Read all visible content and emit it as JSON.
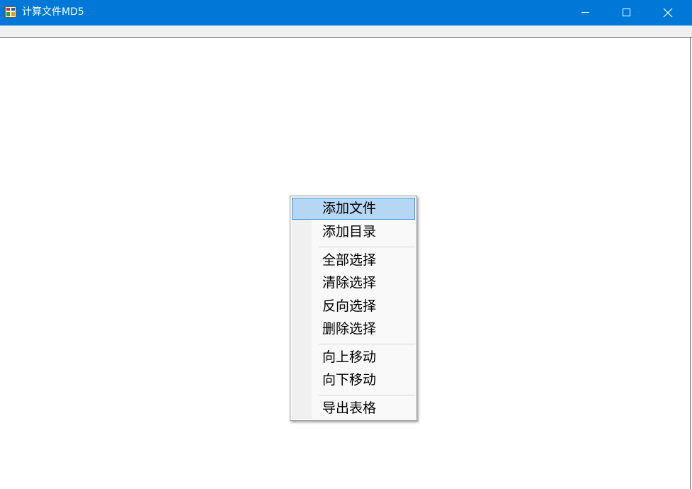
{
  "window": {
    "title": "计算文件MD5",
    "accent_color": "#0078d7",
    "icon": "app-icon",
    "controls": {
      "minimize_icon": "minimize-icon",
      "maximize_icon": "maximize-icon",
      "close_icon": "close-icon"
    }
  },
  "context_menu": {
    "groups": [
      [
        "添加文件",
        "添加目录"
      ],
      [
        "全部选择",
        "清除选择",
        "反向选择",
        "删除选择"
      ],
      [
        "向上移动",
        "向下移动"
      ],
      [
        "导出表格"
      ]
    ],
    "highlighted_item": "添加文件",
    "highlight_color": "#b5d7f3"
  }
}
